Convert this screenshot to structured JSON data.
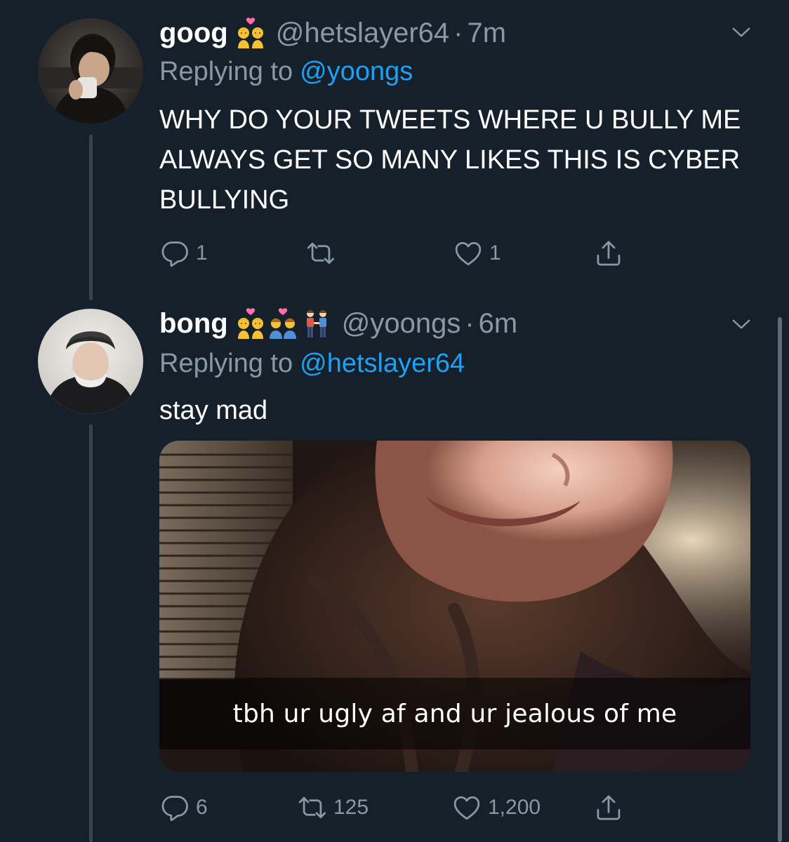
{
  "colors": {
    "background": "#15202b",
    "text_primary": "#ffffff",
    "text_secondary": "#8899a6",
    "link": "#1da1f2",
    "thread_line": "#38444d"
  },
  "tweets": [
    {
      "display_name": "goog",
      "name_emojis": [
        "couple-with-heart-woman-woman-emoji"
      ],
      "handle": "@hetslayer64",
      "separator": "·",
      "time": "7m",
      "replying_prefix": "Replying to",
      "replying_to": "@yoongs",
      "text": "WHY DO YOUR TWEETS WHERE U BULLY ME ALWAYS GET SO MANY LIKES THIS IS CYBER BULLYING",
      "actions": {
        "reply_count": "1",
        "retweet_count": "",
        "like_count": "1"
      }
    },
    {
      "display_name": "bong",
      "name_emojis": [
        "couple-with-heart-woman-woman-emoji",
        "couple-with-heart-man-man-emoji",
        "two-men-holding-hands-emoji"
      ],
      "handle": "@yoongs",
      "separator": "·",
      "time": "6m",
      "replying_prefix": "Replying to",
      "replying_to": "@hetslayer64",
      "text": "stay mad",
      "media": {
        "caption": "tbh ur ugly af and ur jealous of me"
      },
      "actions": {
        "reply_count": "6",
        "retweet_count": "125",
        "like_count": "1,200"
      }
    }
  ]
}
